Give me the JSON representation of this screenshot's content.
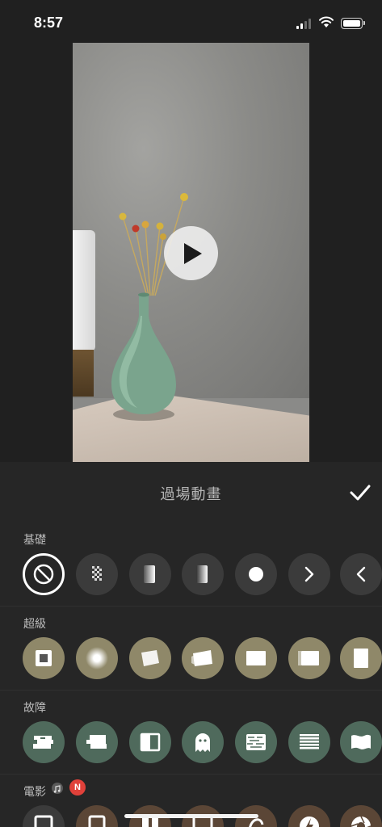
{
  "status_bar": {
    "time": "8:57"
  },
  "panel": {
    "title": "過場動畫",
    "sections": [
      {
        "label": "基礎"
      },
      {
        "label": "超級"
      },
      {
        "label": "故障"
      },
      {
        "label": "電影",
        "badge": "N"
      }
    ]
  },
  "icons": {
    "play": "play-icon",
    "confirm": "checkmark-icon",
    "none": "no-symbol-icon"
  },
  "colors": {
    "background": "#202020",
    "panel": "#262626",
    "basic_item": "#3b3b3b",
    "super_item": "#8f8869",
    "glitch_item": "#4f6a5c",
    "movie_item": "#5b4636",
    "badge": "#e0413a"
  }
}
